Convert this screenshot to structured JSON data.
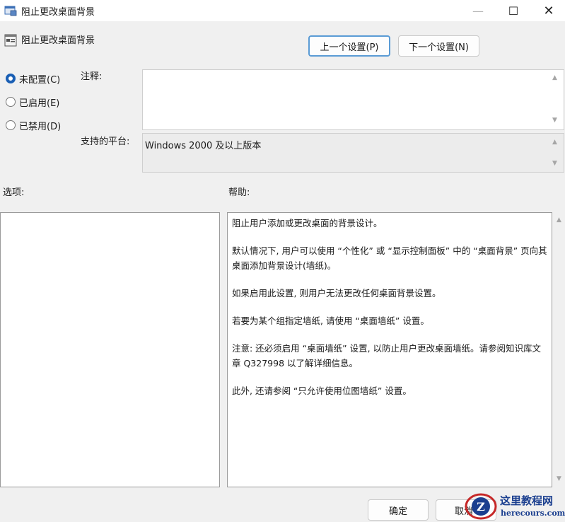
{
  "window": {
    "title": "阻止更改桌面背景",
    "minimize_glyph": "—",
    "maximize_glyph": "☐",
    "close_glyph": "✕"
  },
  "header": {
    "title": "阻止更改桌面背景",
    "prev_label": "上一个设置(P)",
    "next_label": "下一个设置(N)"
  },
  "state": {
    "options": [
      {
        "label": "未配置(C)",
        "checked": true
      },
      {
        "label": "已启用(E)",
        "checked": false
      },
      {
        "label": "已禁用(D)",
        "checked": false
      }
    ]
  },
  "comment": {
    "label": "注释:",
    "value": ""
  },
  "platform": {
    "label": "支持的平台:",
    "value": "Windows 2000 及以上版本"
  },
  "options_label": "选项:",
  "help": {
    "label": "帮助:",
    "paragraphs": [
      "阻止用户添加或更改桌面的背景设计。",
      "默认情况下, 用户可以使用 “个性化” 或 “显示控制面板” 中的 “桌面背景” 页向其桌面添加背景设计(墙纸)。",
      "如果启用此设置, 则用户无法更改任何桌面背景设置。",
      "若要为某个组指定墙纸, 请使用 “桌面墙纸” 设置。",
      "注意: 还必须启用 “桌面墙纸” 设置, 以防止用户更改桌面墙纸。请参阅知识库文章 Q327998 以了解详细信息。",
      "此外, 还请参阅 “只允许使用位图墙纸” 设置。"
    ]
  },
  "footer": {
    "ok_label": "确定",
    "cancel_label": "取消"
  },
  "watermark": {
    "title": "这里教程网",
    "url": "herecours.com"
  },
  "icons": {
    "window": "policy-icon",
    "header": "policy-setting-icon"
  },
  "colors": {
    "accent": "#1a5fb4",
    "focus_border": "#5a9bd5",
    "watermark": "#1b3f8f"
  }
}
